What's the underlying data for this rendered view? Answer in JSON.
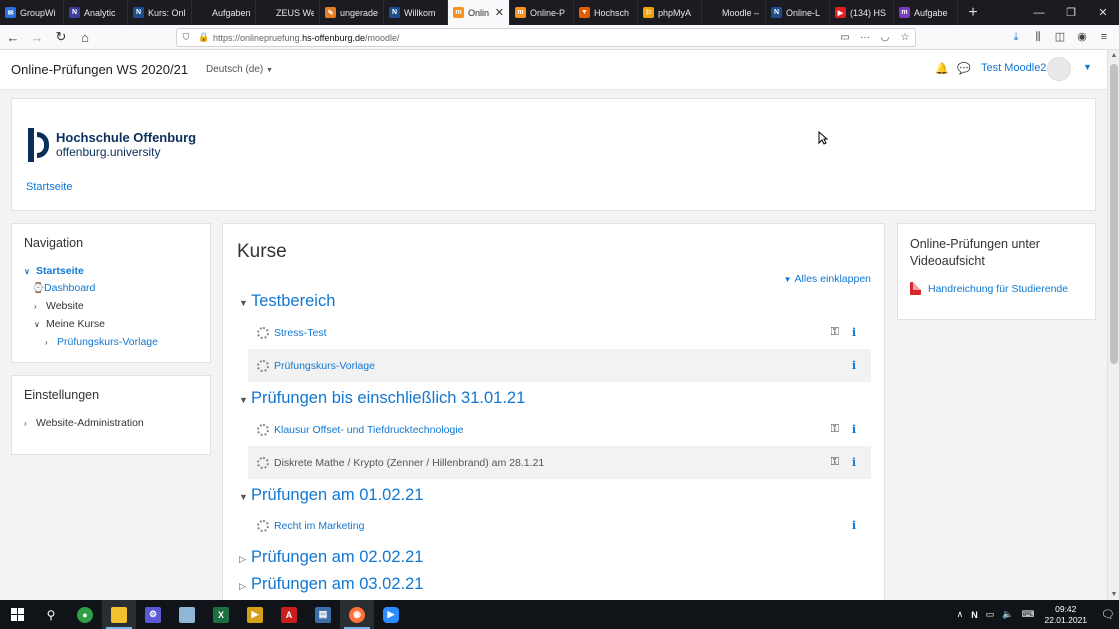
{
  "browser": {
    "tabs": [
      {
        "label": "GroupWi",
        "color": "#2a6fdb",
        "glyph": "✉"
      },
      {
        "label": "Analytic",
        "color": "#3a3f9a",
        "glyph": "N"
      },
      {
        "label": "Kurs: Onl",
        "color": "#1f4e8c",
        "glyph": "N"
      },
      {
        "label": "Aufgabenab",
        "color": "#1c1b22",
        "glyph": ""
      },
      {
        "label": "ZEUS WebSe",
        "color": "#1c1b22",
        "glyph": ""
      },
      {
        "label": "ungerade",
        "color": "#e67e22",
        "glyph": "✎"
      },
      {
        "label": "Willkom",
        "color": "#1f4e8c",
        "glyph": "N"
      },
      {
        "label": "Onlin",
        "color": "#f7931e",
        "glyph": "m",
        "active": true
      },
      {
        "label": "Online-P",
        "color": "#f7931e",
        "glyph": "m"
      },
      {
        "label": "Hochsch",
        "color": "#e65c00",
        "glyph": "▼"
      },
      {
        "label": "phpMyA",
        "color": "#f0a30a",
        "glyph": "⚐"
      },
      {
        "label": "Moodle – IZ",
        "color": "#1c1b22",
        "glyph": ""
      },
      {
        "label": "Online-L",
        "color": "#1f4e8c",
        "glyph": "N"
      },
      {
        "label": "(134) HS",
        "color": "#e02020",
        "glyph": "▶"
      },
      {
        "label": "Aufgabe",
        "color": "#7a3bbd",
        "glyph": "m"
      }
    ],
    "url_prefix": "https://onlinepruefung.",
    "url_host": "hs-offenburg.de",
    "url_path": "/moodle/"
  },
  "header": {
    "site_name": "Online-Prüfungen WS 2020/21",
    "language": "Deutsch (de)",
    "user_name": "Test Moodle2"
  },
  "branding": {
    "line1": "Hochschule Offenburg",
    "line2": "offenburg.university",
    "home_link": "Startseite"
  },
  "navigation": {
    "title": "Navigation",
    "items": [
      "Startseite",
      "Dashboard",
      "Website",
      "Meine Kurse",
      "Prüfungskurs-Vorlage"
    ]
  },
  "settings": {
    "title": "Einstellungen",
    "items": [
      "Website-Administration"
    ]
  },
  "courses": {
    "title": "Kurse",
    "collapse_all": "Alles einklappen",
    "categories": [
      {
        "name": "Testbereich",
        "courses": [
          "Stress-Test",
          "Prüfungskurs-Vorlage"
        ]
      },
      {
        "name": "Prüfungen bis einschließlich 31.01.21",
        "courses": [
          "Klausur Offset- und Tiefdrucktechnologie",
          "Diskrete Mathe / Krypto (Zenner / Hillenbrand) am 28.1.21"
        ]
      },
      {
        "name": "Prüfungen am 01.02.21",
        "courses": [
          "Recht im Marketing"
        ]
      },
      {
        "name": "Prüfungen am 02.02.21",
        "courses": []
      },
      {
        "name": "Prüfungen am 03.02.21",
        "courses": []
      }
    ]
  },
  "side_block": {
    "title": "Online-Prüfungen unter Videoaufsicht",
    "link": "Handreichung für Studierende"
  },
  "taskbar": {
    "time": "09:42",
    "date": "22.01.2021"
  },
  "colors": {
    "link": "#1177d1",
    "brand": "#0b2f5b"
  }
}
